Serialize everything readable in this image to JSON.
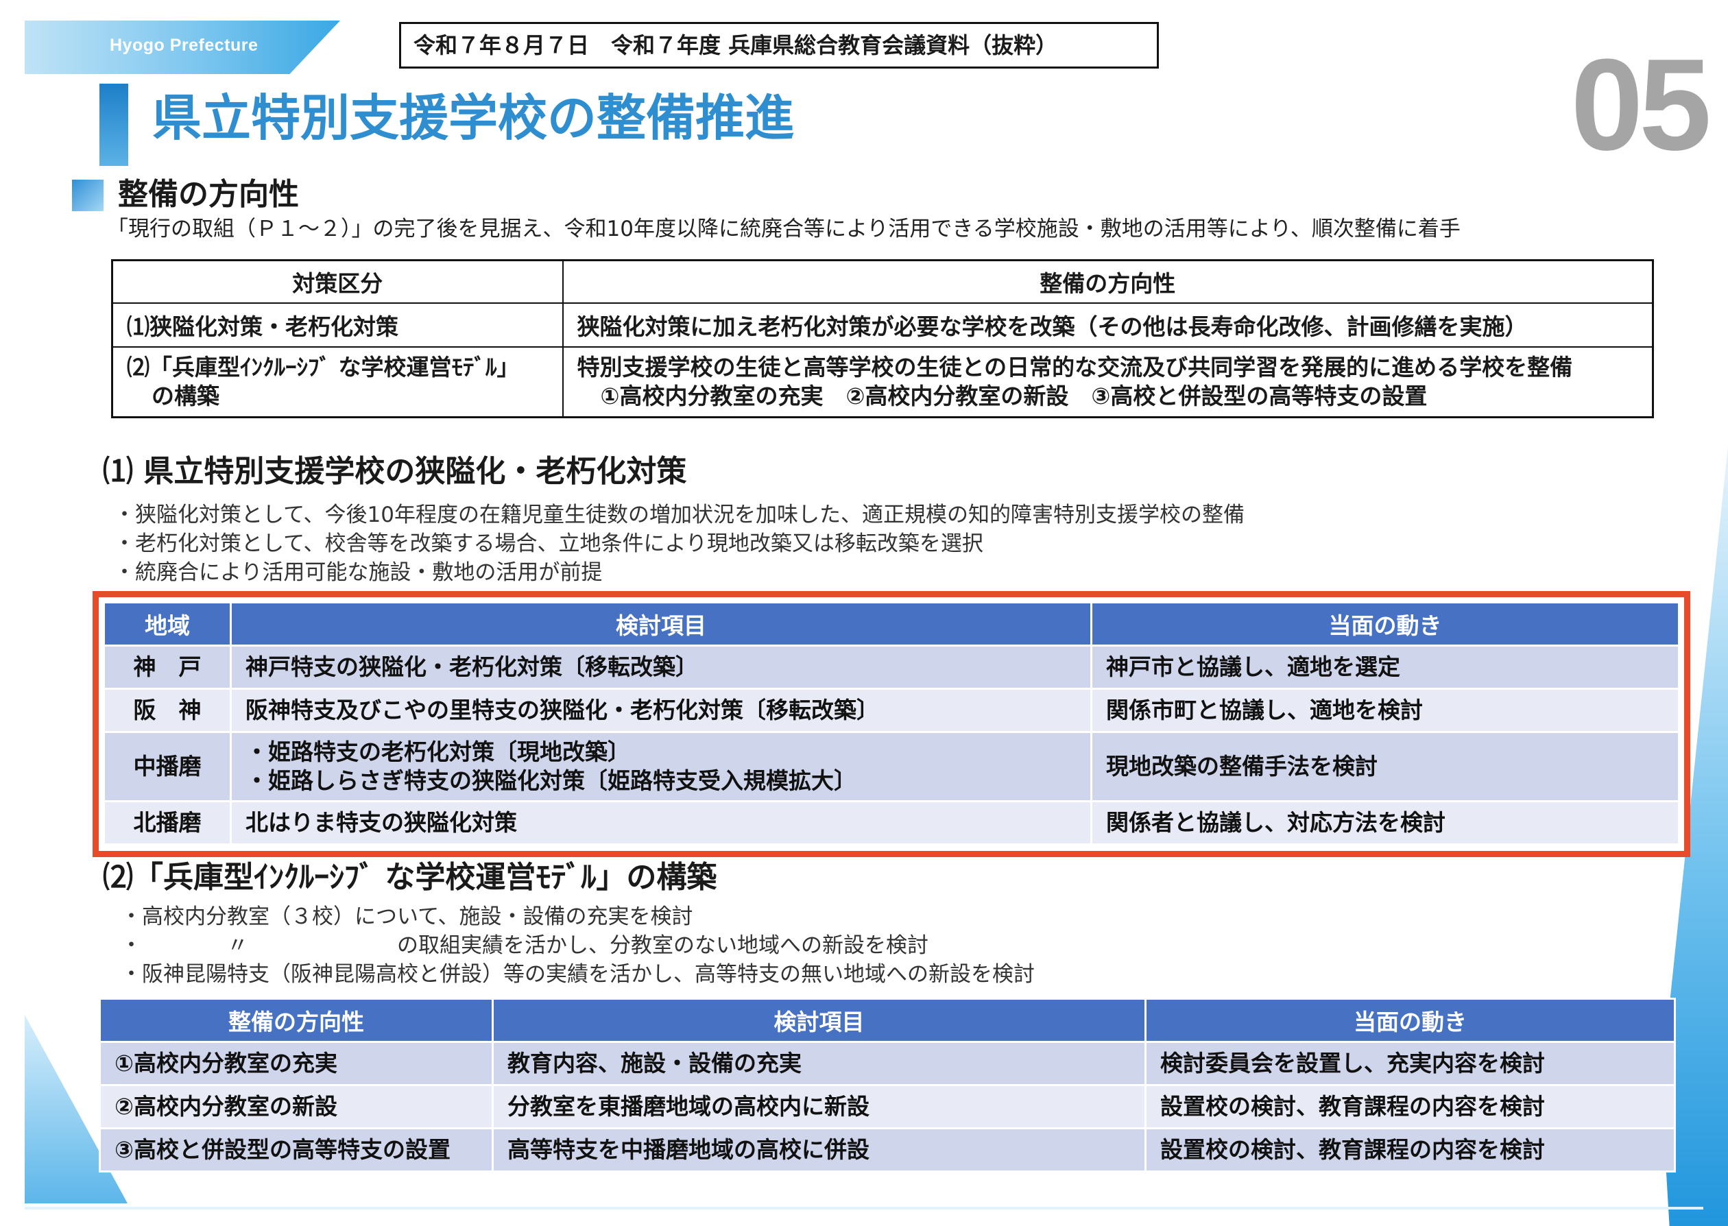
{
  "header": {
    "tag": "Hyogo Prefecture",
    "date_line": "令和７年８月７日　令和７年度 兵庫県総合教育会議資料（抜粋）",
    "page_number": "05",
    "title": "県立特別支援学校の整備推進"
  },
  "direction": {
    "heading": "整備の方向性",
    "description": "「現行の取組（Ｐ１～２）」の完了後を見据え、令和10年度以降に統廃合等により活用できる学校施設・敷地の活用等により、順次整備に着手",
    "table": {
      "headers": [
        "対策区分",
        "整備の方向性"
      ],
      "rows": [
        {
          "category": "⑴狭隘化対策・老朽化対策",
          "direction": "狭隘化対策に加え老朽化対策が必要な学校を改築（その他は長寿命化改修、計画修繕を実施）"
        },
        {
          "category_line1": "⑵「兵庫型ｲﾝｸﾙｰｼﾌﾞ な学校運営ﾓﾃﾞﾙ」",
          "category_line2": "の構築",
          "direction_line1": "特別支援学校の生徒と高等学校の生徒との日常的な交流及び共同学習を発展的に進める学校を整備",
          "direction_line2": "①高校内分教室の充実　②高校内分教室の新設　③高校と併設型の高等特支の設置"
        }
      ]
    }
  },
  "section1": {
    "heading": "⑴ 県立特別支援学校の狭隘化・老朽化対策",
    "bullets": [
      "・狭隘化対策として、今後10年程度の在籍児童生徒数の増加状況を加味した、適正規模の知的障害特別支援学校の整備",
      "・老朽化対策として、校舎等を改築する場合、立地条件により現地改築又は移転改築を選択",
      "・統廃合により活用可能な施設・敷地の活用が前提"
    ],
    "table": {
      "headers": [
        "地域",
        "検討項目",
        "当面の動き"
      ],
      "rows": [
        {
          "region": "神　戸",
          "item": "神戸特支の狭隘化・老朽化対策〔移転改築〕",
          "action": "神戸市と協議し、適地を選定"
        },
        {
          "region": "阪　神",
          "item": "阪神特支及びこやの里特支の狭隘化・老朽化対策〔移転改築〕",
          "action": "関係市町と協議し、適地を検討"
        },
        {
          "region": "中播磨",
          "item_line1": "・姫路特支の老朽化対策〔現地改築〕",
          "item_line2": "・姫路しらさぎ特支の狭隘化対策〔姫路特支受入規模拡大〕",
          "action": "現地改築の整備手法を検討"
        },
        {
          "region": "北播磨",
          "item": "北はりま特支の狭隘化対策",
          "action": "関係者と協議し、対応方法を検討"
        }
      ]
    }
  },
  "section2": {
    "heading": "⑵「兵庫型ｲﾝｸﾙｰｼﾌﾞ な学校運営ﾓﾃﾞﾙ」の構築",
    "bullets": [
      "・高校内分教室（３校）について、施設・設備の充実を検討",
      "・　　　　〃　　　　　　　の取組実績を活かし、分教室のない地域への新設を検討",
      "・阪神昆陽特支（阪神昆陽高校と併設）等の実績を活かし、高等特支の無い地域への新設を検討"
    ],
    "table": {
      "headers": [
        "整備の方向性",
        "検討項目",
        "当面の動き"
      ],
      "rows": [
        {
          "direction": "①高校内分教室の充実",
          "item": "教育内容、施設・設備の充実",
          "action": "検討委員会を設置し、充実内容を検討"
        },
        {
          "direction": "②高校内分教室の新設",
          "item": "分教室を東播磨地域の高校内に新設",
          "action": "設置校の検討、教育課程の内容を検討"
        },
        {
          "direction": "③高校と併設型の高等特支の設置",
          "item": "高等特支を中播磨地域の高校に併設",
          "action": "設置校の検討、教育課程の内容を検討"
        }
      ]
    }
  },
  "colors": {
    "title_blue": "#2e8ecf",
    "table_header": "#4772c4",
    "row_dark": "#cfd5ea",
    "row_light": "#e8ebf5",
    "highlight_border": "#e84b2a",
    "page_number_gray": "#a5a5a5"
  }
}
